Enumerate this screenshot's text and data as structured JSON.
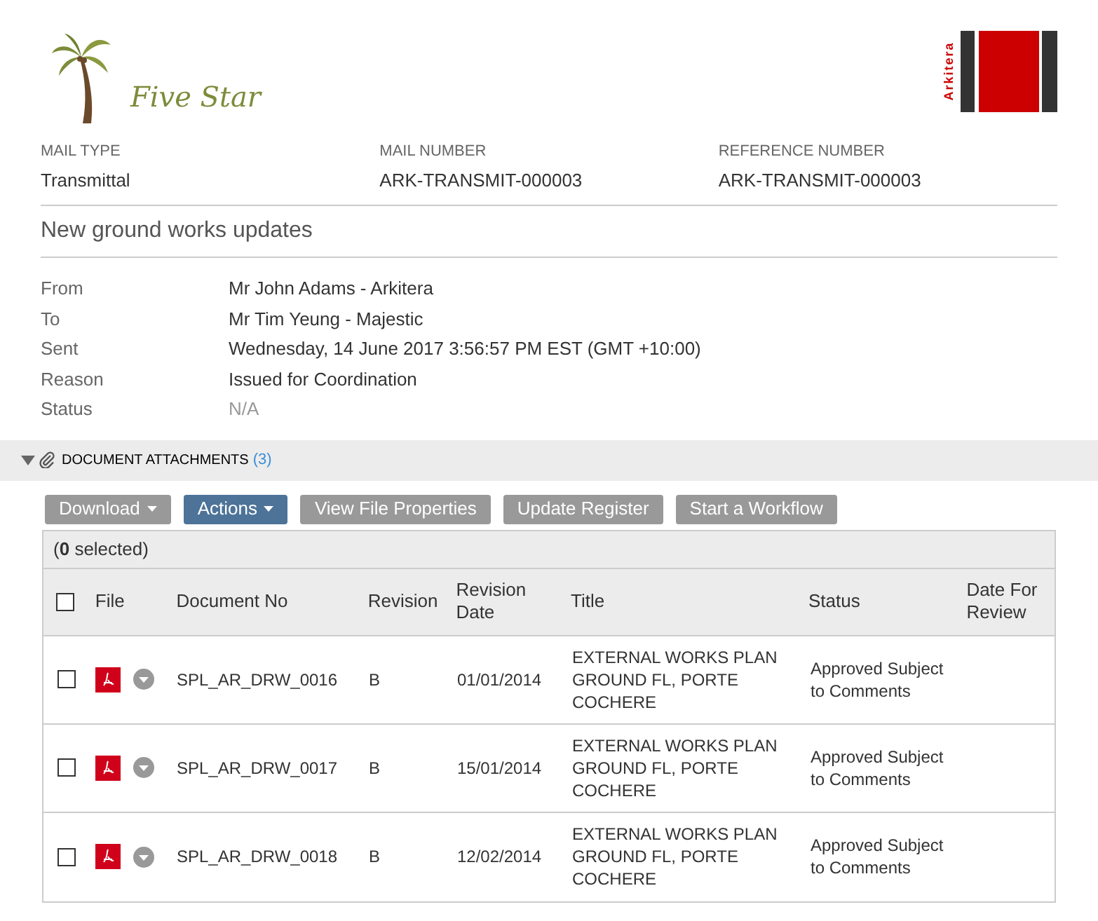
{
  "header": {
    "brand": "Five Star",
    "partner": "Arkitera"
  },
  "meta": [
    {
      "label": "MAIL TYPE",
      "value": "Transmittal"
    },
    {
      "label": "MAIL NUMBER",
      "value": "ARK-TRANSMIT-000003"
    },
    {
      "label": "REFERENCE NUMBER",
      "value": "ARK-TRANSMIT-000003"
    }
  ],
  "subject": "New ground works updates",
  "details": [
    {
      "label": "From",
      "value": "Mr John Adams - Arkitera",
      "muted": false
    },
    {
      "label": "To",
      "value": "Mr Tim Yeung - Majestic",
      "muted": false
    },
    {
      "label": "Sent",
      "value": "Wednesday, 14 June 2017 3:56:57 PM EST (GMT +10:00)",
      "muted": false
    },
    {
      "label": "Reason",
      "value": "Issued for Coordination",
      "muted": false
    },
    {
      "label": "Status",
      "value": "N/A",
      "muted": true
    }
  ],
  "attachments": {
    "title": "DOCUMENT ATTACHMENTS",
    "count": "(3)",
    "expanded": true,
    "buttons": [
      {
        "label": "Download",
        "kind": "dropdown"
      },
      {
        "label": "Actions",
        "kind": "primary"
      },
      {
        "label": "View File Properties",
        "kind": "button"
      },
      {
        "label": "Update Register",
        "kind": "button"
      },
      {
        "label": "Start a Workflow",
        "kind": "button"
      }
    ],
    "selection": "(**0** selected)",
    "table": {
      "select_all_checked": false,
      "columns": [
        "File",
        "Document No",
        "Revision",
        "Revision Date",
        "Title",
        "Status",
        "Date For Review"
      ],
      "rows": [
        {
          "checked": false,
          "document_no": "SPL_AR_DRW_0016",
          "revision": "B",
          "revision_date": "01/01/2014",
          "title": "EXTERNAL WORKS PLAN GROUND FL, PORTE COCHERE",
          "status": "Approved Subject to Comments"
        },
        {
          "checked": false,
          "document_no": "SPL_AR_DRW_0017",
          "revision": "B",
          "revision_date": "15/01/2014",
          "title": "EXTERNAL WORKS PLAN GROUND FL, PORTE COCHERE",
          "status": "Approved Subject to Comments"
        },
        {
          "checked": false,
          "document_no": "SPL_AR_DRW_0018",
          "revision": "B",
          "revision_date": "12/02/2014",
          "title": "EXTERNAL WORKS PLAN GROUND FL, PORTE COCHERE",
          "status": "Approved Subject to Comments"
        }
      ]
    }
  }
}
